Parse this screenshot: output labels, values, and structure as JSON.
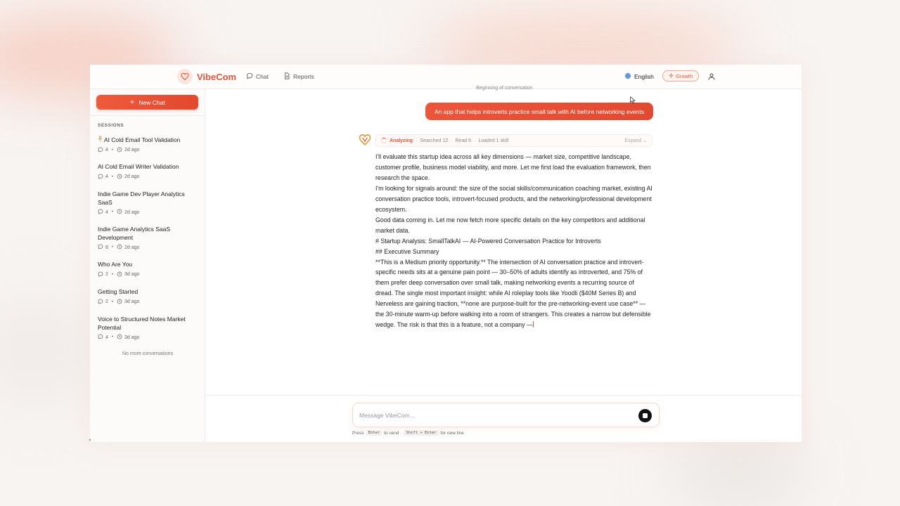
{
  "app": {
    "name": "VibeCom",
    "brand_color": "#e8553a"
  },
  "header": {
    "nav": [
      {
        "label": "Chat",
        "icon": "chat-bubble-icon"
      },
      {
        "label": "Reports",
        "icon": "document-icon"
      }
    ],
    "language": "English",
    "plan_badge": "Growth"
  },
  "sidebar": {
    "new_chat_label": "New Chat",
    "sessions_heading": "SESSIONS",
    "sessions": [
      {
        "title": "AI Cold Email Tool Validation",
        "messages": "4",
        "age": "2d ago",
        "pinned": true
      },
      {
        "title": "AI Cold Email Writer Validation",
        "messages": "4",
        "age": "2d ago"
      },
      {
        "title": "Indie Game Dev Player Analytics SaaS",
        "messages": "4",
        "age": "2d ago"
      },
      {
        "title": "Indie Game Analytics SaaS Development",
        "messages": "8",
        "age": "2d ago"
      },
      {
        "title": "Who Are You",
        "messages": "2",
        "age": "3d ago"
      },
      {
        "title": "Getting Started",
        "messages": "2",
        "age": "3d ago"
      },
      {
        "title": "Voice to Structured Notes Market Potential",
        "messages": "4",
        "age": "3d ago"
      }
    ],
    "no_more": "No more conversations"
  },
  "conversation": {
    "beginning_label": "Beginning of conversation",
    "user_message": "An app that helps introverts practice small talk with AI before networking events",
    "status": {
      "state": "Analyzing",
      "searched": "Searched 12",
      "read": "Read 6",
      "loaded": "Loaded 1 skill",
      "expand": "Expand"
    },
    "answer_paragraphs": [
      "I'll evaluate this startup idea across all key dimensions — market size, competitive landscape, customer profile, business model viability, and more. Let me first load the evaluation framework, then research the space.",
      "I'm looking for signals around: the size of the social skills/communication coaching market, existing AI conversation practice tools, introvert-focused products, and the networking/professional development ecosystem.",
      "Good data coming in. Let me now fetch more specific details on the key competitors and additional market data.",
      "# Startup Analysis: SmallTalkAI — AI-Powered Conversation Practice for Introverts",
      "## Executive Summary",
      "**This is a Medium priority opportunity.** The intersection of AI conversation practice and introvert-specific needs sits at a genuine pain point — 30–50% of adults identify as introverted, and 75% of them prefer deep conversation over small talk, making networking events a recurring source of dread. The single most important insight: while AI roleplay tools like Yoodli ($40M Series B) and Nerveless are gaining traction, **none are purpose-built for the pre-networking-event use case** — the 30-minute warm-up before walking into a room of strangers. This creates a narrow but defensible wedge. The risk is that this is a feature, not a company —"
    ]
  },
  "composer": {
    "placeholder": "Message VibeCom...",
    "value": "",
    "hint_press": "Press",
    "hint_enter_key": "Enter",
    "hint_to_send": "to send ·",
    "hint_shift_key": "Shift + Enter",
    "hint_new_line": "for new line"
  }
}
